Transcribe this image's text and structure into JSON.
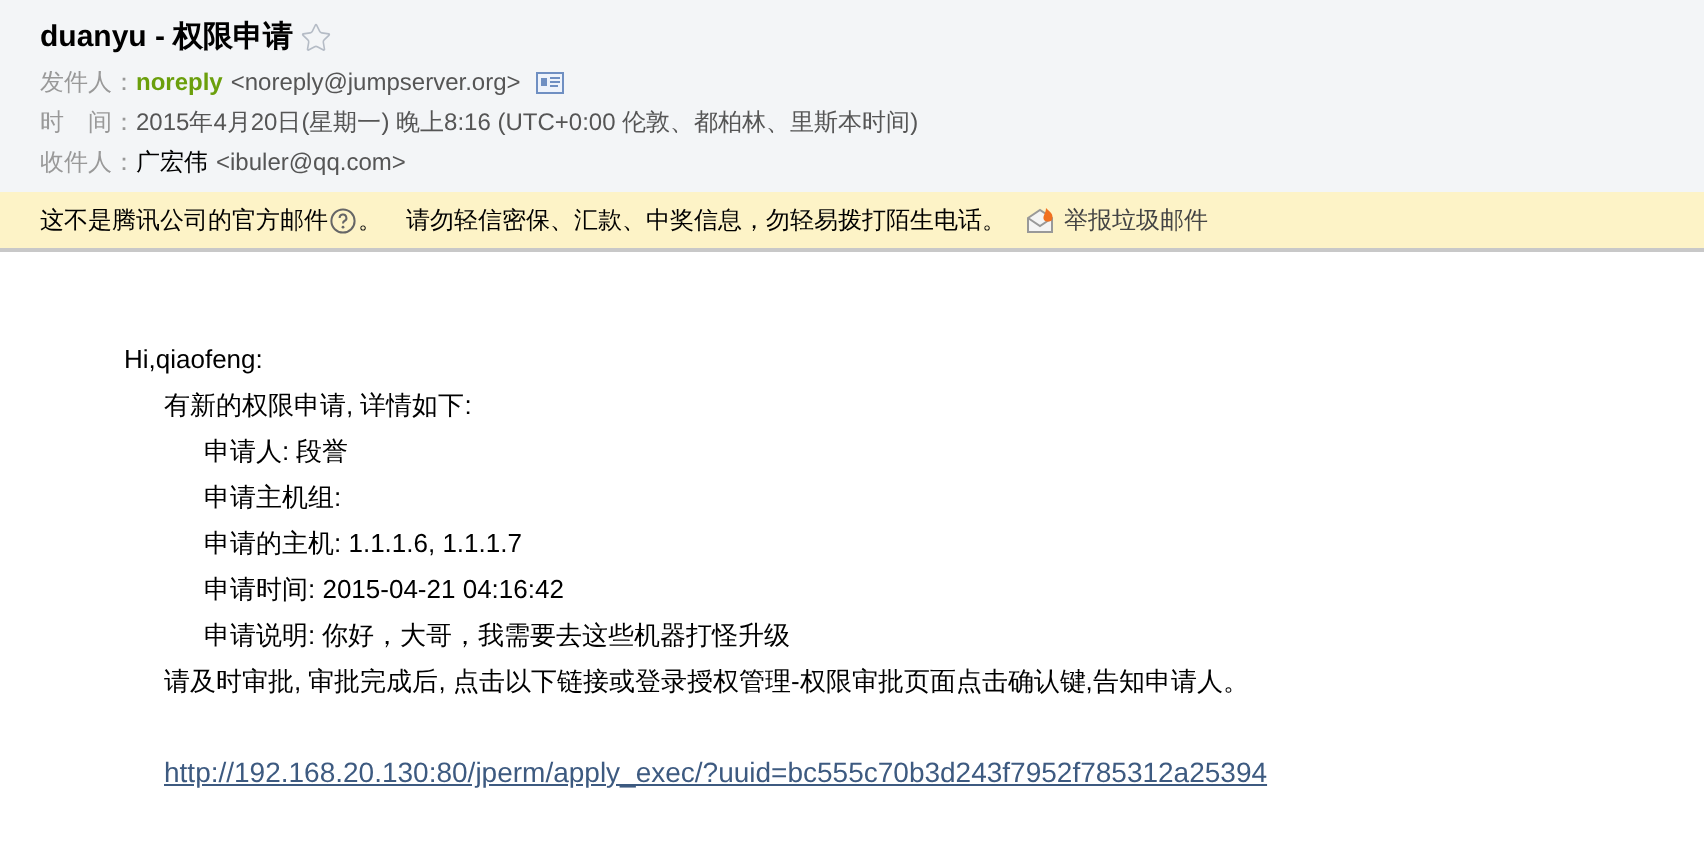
{
  "header": {
    "subject": "duanyu - 权限申请",
    "starred": false,
    "from_label": "发件人：",
    "from_name": "noreply",
    "from_address": "<noreply@jumpserver.org>",
    "time_label": "时　间：",
    "time": "2015年4月20日(星期一) 晚上8:16 (UTC+0:00 伦敦、都柏林、里斯本时间)",
    "to_label": "收件人：",
    "to_name": "广宏伟",
    "to_address": "<ibuler@qq.com>"
  },
  "warning": {
    "text": "这不是腾讯公司的官方邮件",
    "punct": "。",
    "advice": "请勿轻信密保、汇款、中奖信息，勿轻易拨打陌生电话。",
    "report": "举报垃圾邮件"
  },
  "body": {
    "greeting": "Hi,qiaofeng:",
    "intro": "有新的权限申请, 详情如下:",
    "details": [
      {
        "text": "申请人: 段誉"
      },
      {
        "text": "申请主机组:"
      },
      {
        "text": "申请的主机: 1.1.1.6, 1.1.1.7"
      },
      {
        "text": "申请时间: 2015-04-21 04:16:42"
      },
      {
        "text": "申请说明: 你好，大哥，我需要去这些机器打怪升级"
      }
    ],
    "instruction": "请及时审批, 审批完成后, 点击以下链接或登录授权管理-权限审批页面点击确认键,告知申请人。",
    "link": "http://192.168.20.130:80/jperm/apply_exec/?uuid=bc555c70b3d243f7952f785312a25394"
  }
}
